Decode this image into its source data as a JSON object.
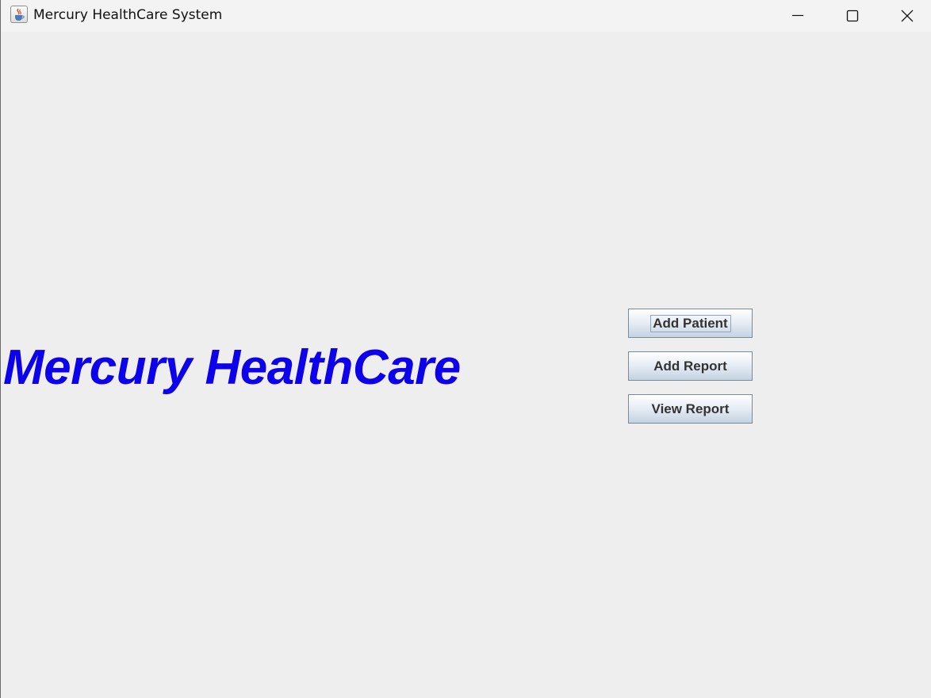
{
  "window": {
    "title": "Mercury HealthCare System",
    "icon": "java-cup-icon",
    "controls": [
      "minimize-icon",
      "maximize-icon",
      "close-icon"
    ]
  },
  "main": {
    "brand_text": "Mercury HealthCare",
    "brand_color": "#0d00ea",
    "buttons": [
      {
        "label": "Add Patient",
        "focused": true
      },
      {
        "label": "Add Report",
        "focused": false
      },
      {
        "label": "View Report",
        "focused": false
      }
    ]
  },
  "colors": {
    "background": "#eeeeee",
    "titlebar": "#f3f3f3",
    "button_text": "#333333",
    "button_border": "#7a8a99"
  }
}
